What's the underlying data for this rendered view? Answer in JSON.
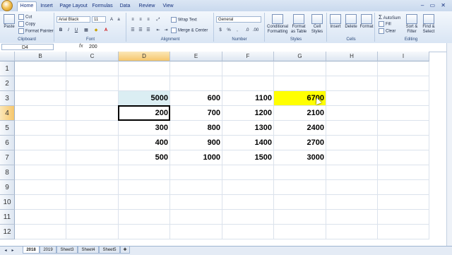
{
  "ribbon_tabs": [
    "Home",
    "Insert",
    "Page Layout",
    "Formulas",
    "Data",
    "Review",
    "View"
  ],
  "clipboard": {
    "paste": "Paste",
    "cut": "Cut",
    "copy": "Copy",
    "format_painter": "Format Painter",
    "label": "Clipboard"
  },
  "font": {
    "name": "Arial Black",
    "size": "11",
    "bold": "B",
    "italic": "I",
    "underline": "U",
    "label": "Font"
  },
  "alignment": {
    "wrap": "Wrap Text",
    "merge": "Merge & Center",
    "label": "Alignment"
  },
  "number": {
    "format": "General",
    "currency": "$",
    "percent": "%",
    "comma": ",",
    "label": "Number"
  },
  "styles": {
    "conditional": "Conditional Formatting",
    "format_table": "Format as Table",
    "cell_styles": "Cell Styles",
    "label": "Styles"
  },
  "cells": {
    "insert": "Insert",
    "delete": "Delete",
    "format": "Format",
    "label": "Cells"
  },
  "editing": {
    "autosum": "AutoSum",
    "fill": "Fill",
    "clear": "Clear",
    "sort": "Sort & Filter",
    "find": "Find & Select",
    "label": "Editing"
  },
  "formula_bar": {
    "name_box": "D4",
    "fx": "fx",
    "value": "200"
  },
  "columns": [
    "B",
    "C",
    "D",
    "E",
    "F",
    "G",
    "H",
    "I"
  ],
  "rows": [
    "1",
    "2",
    "3",
    "4",
    "5",
    "6",
    "7",
    "8",
    "9",
    "10",
    "11",
    "12"
  ],
  "cells_data": {
    "D3": "5000",
    "E3": "600",
    "F3": "1100",
    "G3": "6700",
    "D4": "200",
    "E4": "700",
    "F4": "1200",
    "G4": "2100",
    "D5": "300",
    "E5": "800",
    "F5": "1300",
    "G5": "2400",
    "D6": "400",
    "E6": "900",
    "F6": "1400",
    "G6": "2700",
    "D7": "500",
    "E7": "1000",
    "F7": "1500",
    "G7": "3000"
  },
  "colors": {
    "d3_fill": "#dbeef3",
    "g3_fill": "#ffff00",
    "selection_header": "#f6c66b"
  },
  "sheets": [
    "2018",
    "2019",
    "Sheet3",
    "Sheet4",
    "Sheet5"
  ],
  "active_sheet": "2018"
}
